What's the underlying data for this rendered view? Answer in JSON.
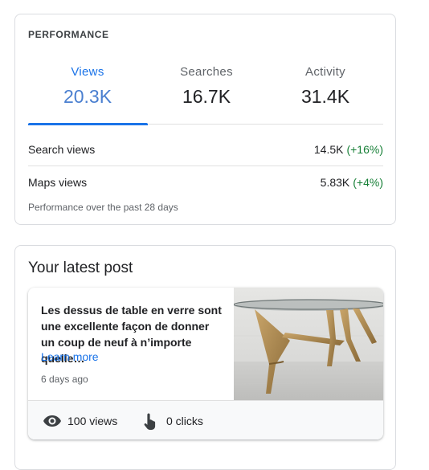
{
  "performance": {
    "title": "PERFORMANCE",
    "tabs": [
      {
        "label": "Views",
        "value": "20.3K",
        "active": true
      },
      {
        "label": "Searches",
        "value": "16.7K",
        "active": false
      },
      {
        "label": "Activity",
        "value": "31.4K",
        "active": false
      }
    ],
    "rows": [
      {
        "label": "Search views",
        "value": "14.5K",
        "change": "(+16%)"
      },
      {
        "label": "Maps views",
        "value": "5.83K",
        "change": "(+4%)"
      }
    ],
    "footnote": "Performance over the past 28 days"
  },
  "latest_post": {
    "title": "Your latest post",
    "text": "Les dessus de table en verre sont une excellente façon de donner un coup de neuf à n’importe quelle…",
    "learn_more": "Learn more",
    "date": "6 days ago",
    "views": "100 views",
    "clicks": "0 clicks"
  },
  "colors": {
    "accent": "#1a73e8",
    "positive": "#188038",
    "border": "#dadce0"
  }
}
